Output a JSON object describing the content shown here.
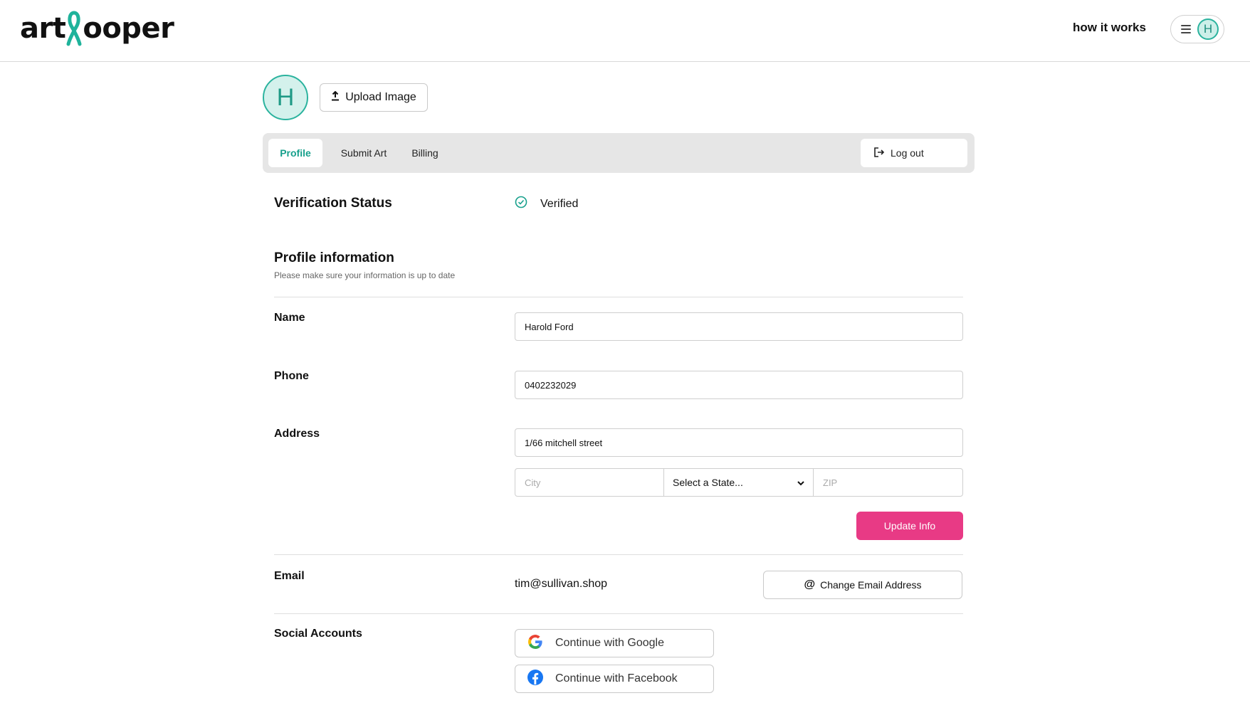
{
  "header": {
    "logo_text_left": "art",
    "logo_text_right": "ooper",
    "how_it_works": "how it works",
    "avatar_initial": "H"
  },
  "profile_photo": {
    "initial": "H",
    "upload_label": "Upload Image"
  },
  "tabs": [
    {
      "label": "Profile",
      "active": true
    },
    {
      "label": "Submit Art",
      "active": false
    },
    {
      "label": "Billing",
      "active": false
    }
  ],
  "logout_label": "Log out",
  "verification": {
    "title": "Verification Status",
    "status": "Verified"
  },
  "profile_info": {
    "title": "Profile information",
    "subtitle": "Please make sure your information is up to date"
  },
  "fields": {
    "name_label": "Name",
    "name_value": "Harold Ford",
    "phone_label": "Phone",
    "phone_value": "0402232029",
    "address_label": "Address",
    "address_value": "1/66 mitchell street",
    "city_placeholder": "City",
    "state_selected": "Select a State...",
    "zip_placeholder": "ZIP"
  },
  "update_label": "Update Info",
  "email": {
    "label": "Email",
    "value": "tim@sullivan.shop",
    "change_label": "Change Email Address"
  },
  "social": {
    "label": "Social Accounts",
    "google_label": "Continue with Google",
    "facebook_label": "Continue with Facebook"
  },
  "colors": {
    "accent_teal": "#17a08c",
    "primary_pink": "#e83a85",
    "tabbar_bg": "#e6e6e6"
  }
}
